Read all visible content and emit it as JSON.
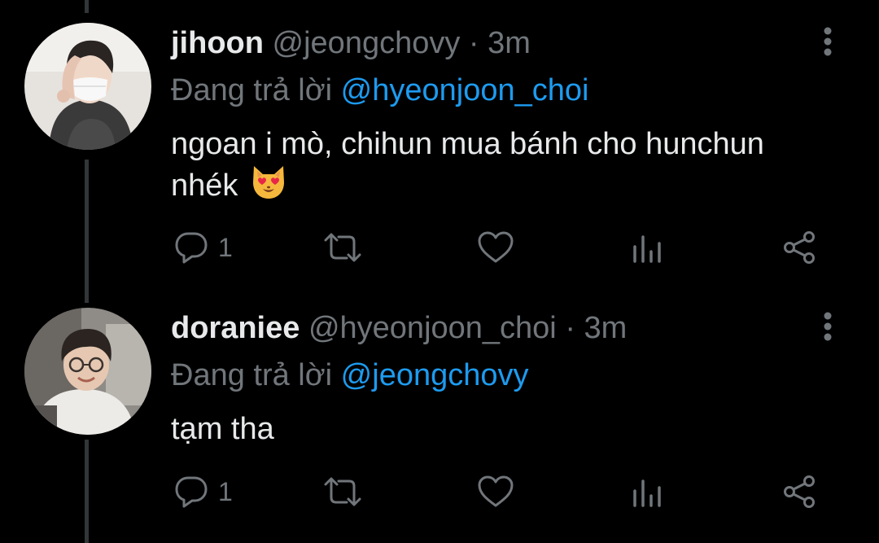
{
  "colors": {
    "background": "#000000",
    "text": "#e7e9ea",
    "muted": "#71767b",
    "accent": "#1d9bf0",
    "thread_line": "#333639"
  },
  "tweets": [
    {
      "display_name": "jihoon",
      "handle": "@jeongchovy",
      "separator": "·",
      "time": "3m",
      "reply_prefix": "Đang trả lời",
      "reply_to": "@hyeonjoon_choi",
      "text": "ngoan i mò, chihun mua bánh cho hunchun nhék",
      "emoji": "smiling-cat-heart-eyes",
      "reply_count": "1",
      "avatar": "masked-person-photo"
    },
    {
      "display_name": "doraniee",
      "handle": "@hyeonjoon_choi",
      "separator": "·",
      "time": "3m",
      "reply_prefix": "Đang trả lời",
      "reply_to": "@jeongchovy",
      "text": "tạm tha",
      "reply_count": "1",
      "avatar": "smiling-person-glasses-photo"
    }
  ]
}
